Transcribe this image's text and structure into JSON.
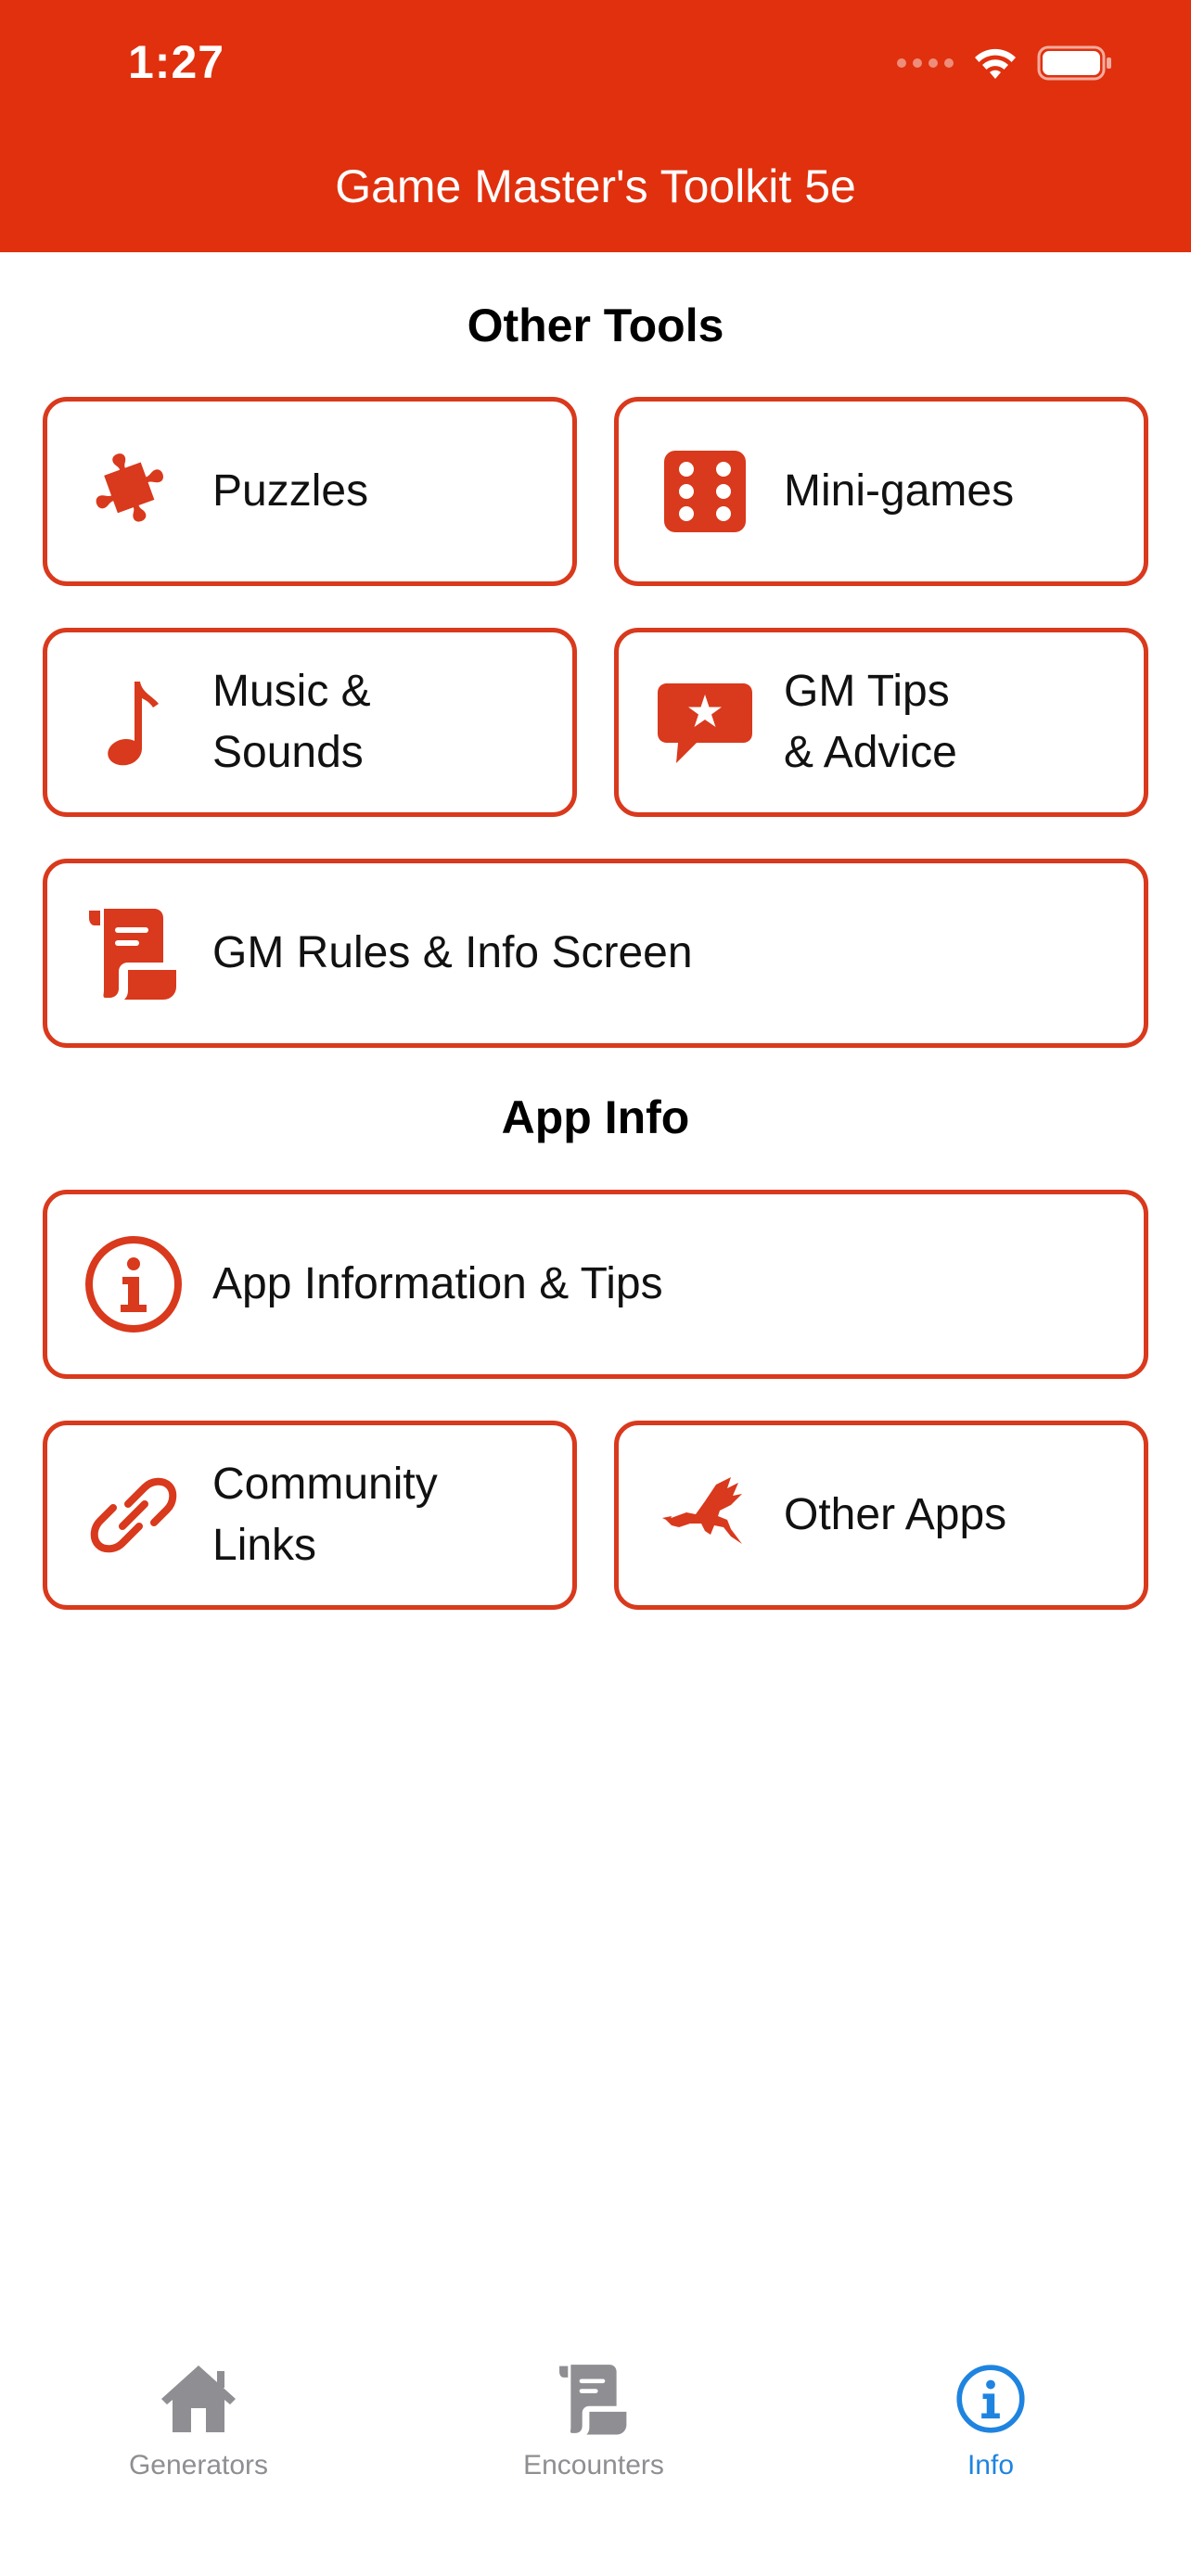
{
  "status_bar": {
    "time": "1:27"
  },
  "header": {
    "title": "Game Master's Toolkit 5e"
  },
  "colors": {
    "brand_red": "#e0300e",
    "tile_border": "#d9391c",
    "active_tab": "#1f84e0",
    "inactive_tab": "#8e8e93"
  },
  "sections": {
    "other_tools": {
      "title": "Other Tools",
      "items": [
        {
          "label": "Puzzles",
          "icon": "puzzle-piece-icon"
        },
        {
          "label": "Mini-games",
          "icon": "dice-icon"
        },
        {
          "label": "Music &\nSounds",
          "icon": "music-note-icon"
        },
        {
          "label": "GM Tips\n& Advice",
          "icon": "star-speech-bubble-icon"
        },
        {
          "label": "GM Rules & Info Screen",
          "icon": "scroll-icon"
        }
      ]
    },
    "app_info": {
      "title": "App Info",
      "items": [
        {
          "label": "App Information & Tips",
          "icon": "info-circle-icon"
        },
        {
          "label": "Community\nLinks",
          "icon": "link-icon"
        },
        {
          "label": "Other Apps",
          "icon": "dragon-icon"
        }
      ]
    }
  },
  "tabbar": {
    "tabs": [
      {
        "label": "Generators",
        "icon": "house-icon",
        "active": false
      },
      {
        "label": "Encounters",
        "icon": "scroll-icon",
        "active": false
      },
      {
        "label": "Info",
        "icon": "info-circle-icon",
        "active": true
      }
    ]
  }
}
